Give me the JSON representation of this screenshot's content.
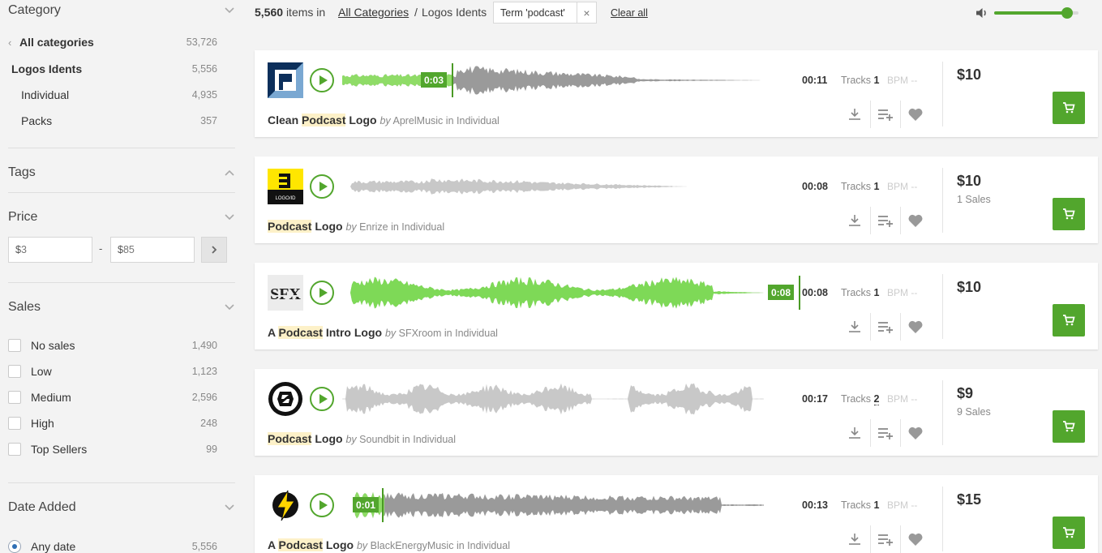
{
  "sidebar": {
    "category_title": "Category",
    "categories": [
      {
        "label": "All categories",
        "count": "53,726"
      },
      {
        "label": "Logos Idents",
        "count": "5,556"
      },
      {
        "label": "Individual",
        "count": "4,935"
      },
      {
        "label": "Packs",
        "count": "357"
      }
    ],
    "tags_title": "Tags",
    "price_title": "Price",
    "price_min_currency": "$",
    "price_min": "3",
    "price_max_currency": "$",
    "price_max": "85",
    "price_dash": "-",
    "sales_title": "Sales",
    "sales_options": [
      {
        "label": "No sales",
        "count": "1,490"
      },
      {
        "label": "Low",
        "count": "1,123"
      },
      {
        "label": "Medium",
        "count": "2,596"
      },
      {
        "label": "High",
        "count": "248"
      },
      {
        "label": "Top Sellers",
        "count": "99"
      }
    ],
    "date_title": "Date Added",
    "date_options": [
      {
        "label": "Any date",
        "count": "5,556",
        "selected": true
      }
    ]
  },
  "topbar": {
    "count": "5,560",
    "count_suffix": "items in",
    "crumb_all": "All Categories",
    "crumb_sep": "/",
    "crumb_current": "Logos Idents",
    "term_chip": "Term 'podcast'",
    "term_chip_close": "×",
    "clear_all": "Clear all",
    "volume_level": 0.87
  },
  "items": [
    {
      "thumb": "logo-p-icon",
      "playhead": "0:03",
      "duration": "00:11",
      "tracks_label": "Tracks",
      "tracks": "1",
      "bpm": "BPM --",
      "title_pre": "Clean ",
      "title_hl": "Podcast",
      "title_post": " Logo",
      "by": "by",
      "author": "AprelMusic",
      "in": "in",
      "category": "Individual",
      "price": "$10",
      "sales": "",
      "progress": 0.26
    },
    {
      "thumb": "logo-e-icon",
      "thumb_text": "LOGO/ID",
      "playhead": "",
      "duration": "00:08",
      "tracks_label": "Tracks",
      "tracks": "1",
      "bpm": "BPM --",
      "title_pre": "",
      "title_hl": "Podcast",
      "title_post": " Logo",
      "by": "by",
      "author": "Enrize",
      "in": "in",
      "category": "Individual",
      "price": "$10",
      "sales": "1 Sales",
      "progress": 0
    },
    {
      "thumb": "sfx-icon",
      "thumb_text": "SFX",
      "playhead": "0:08",
      "duration": "00:08",
      "tracks_label": "Tracks",
      "tracks": "1",
      "bpm": "BPM --",
      "title_pre": "A ",
      "title_hl": "Podcast",
      "title_post": " Intro Logo",
      "by": "by",
      "author": "SFXroom",
      "in": "in",
      "category": "Individual",
      "price": "$10",
      "sales": "",
      "progress": 1
    },
    {
      "thumb": "soundbit-icon",
      "playhead": "",
      "duration": "00:17",
      "tracks_label": "Tracks",
      "tracks": "2",
      "bpm": "BPM --",
      "title_pre": "",
      "title_hl": "Podcast",
      "title_post": " Logo",
      "by": "by",
      "author": "Soundbit",
      "in": "in",
      "category": "Individual",
      "price": "$9",
      "sales": "9 Sales",
      "progress": 0
    },
    {
      "thumb": "lightning-icon",
      "playhead": "0:01",
      "duration": "00:13",
      "tracks_label": "Tracks",
      "tracks": "1",
      "bpm": "BPM --",
      "title_pre": "A ",
      "title_hl": "Podcast",
      "title_post": " Logo",
      "by": "by",
      "author": "BlackEnergyMusic",
      "in": "in",
      "category": "Individual",
      "price": "$15",
      "sales": "",
      "progress": 0.1
    }
  ],
  "colors": {
    "accent": "#52a62d",
    "wave_gray": "#aaaaaa",
    "wave_light": "#cccccc",
    "highlight": "#fdf1c8"
  }
}
